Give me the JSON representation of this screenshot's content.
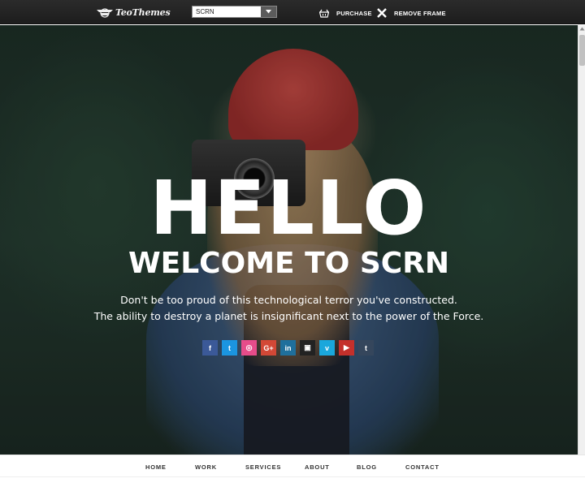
{
  "topbar": {
    "logo_text": "TeoThemes",
    "theme_select": {
      "value": "SCRN"
    },
    "purchase_label": "PURCHASE",
    "remove_frame_label": "REMOVE FRAME"
  },
  "hero": {
    "heading": "HELLO",
    "subheading": "WELCOME TO SCRN",
    "tagline_line1": "Don't be too proud of this technological terror you've constructed.",
    "tagline_line2": "The ability to destroy a planet is insignificant next to the power of the Force.",
    "social": [
      {
        "icon": "facebook-icon",
        "glyph": "f",
        "color": "#3b5998"
      },
      {
        "icon": "twitter-icon",
        "glyph": "t",
        "color": "#1b95e0"
      },
      {
        "icon": "dribbble-icon",
        "glyph": "◎",
        "color": "#e64c8a"
      },
      {
        "icon": "google-plus-icon",
        "glyph": "G+",
        "color": "#d34836"
      },
      {
        "icon": "linkedin-icon",
        "glyph": "in",
        "color": "#1f6f9c"
      },
      {
        "icon": "instagram-icon",
        "glyph": "▣",
        "color": "#222222"
      },
      {
        "icon": "vimeo-icon",
        "glyph": "v",
        "color": "#1aa7dc"
      },
      {
        "icon": "youtube-icon",
        "glyph": "▶",
        "color": "#c4302b"
      },
      {
        "icon": "tumblr-icon",
        "glyph": "t",
        "color": "#35465c"
      }
    ]
  },
  "nav": {
    "items": [
      "HOME",
      "WORK",
      "SERVICES",
      "ABOUT",
      "BLOG",
      "CONTACT"
    ]
  }
}
